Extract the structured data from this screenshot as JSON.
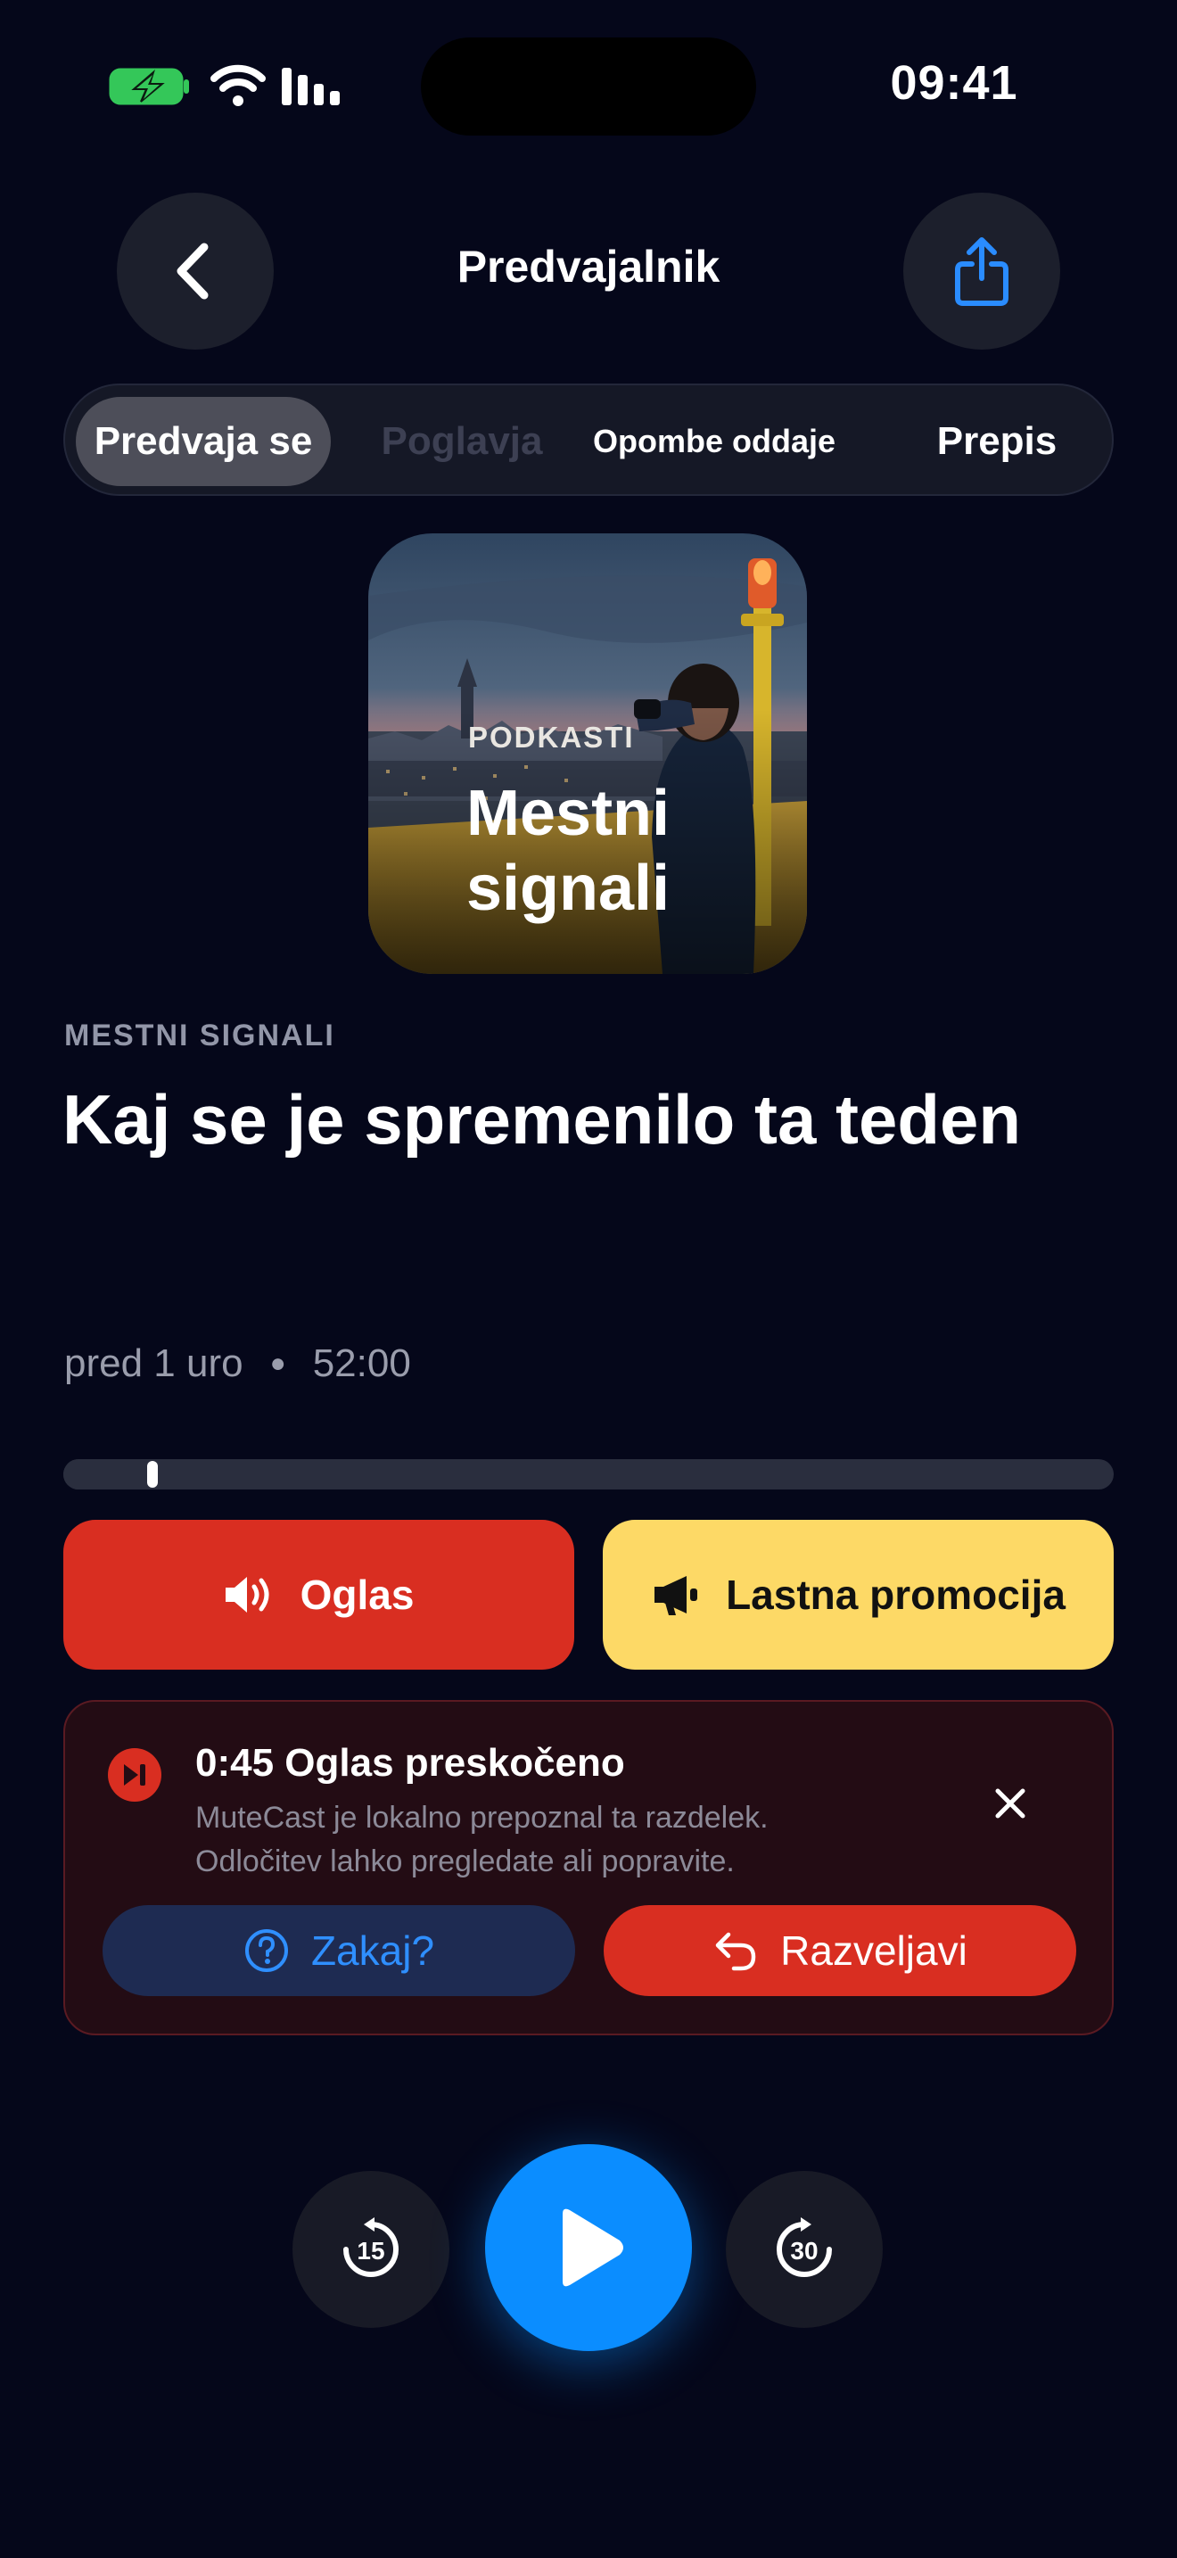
{
  "status_bar": {
    "time": "09:41"
  },
  "header": {
    "title": "Predvajalnik"
  },
  "tabs": [
    {
      "label": "Predvaja se",
      "active": true
    },
    {
      "label": "Poglavja",
      "active": false
    },
    {
      "label": "Opombe oddaje",
      "active": false
    },
    {
      "label": "Prepis",
      "active": false
    }
  ],
  "artwork": {
    "kicker": "PODKASTI",
    "title_line1": "Mestni",
    "title_line2": "signali"
  },
  "episode": {
    "show": "MESTNI SIGNALI",
    "title": "Kaj se je spremenilo ta teden",
    "published": "pred 1 uro",
    "duration": "52:00",
    "progress": 0.085
  },
  "segments": {
    "ad_label": "Oglas",
    "promo_label": "Lastna promocija"
  },
  "skip_notice": {
    "title": "0:45 Oglas preskočeno",
    "line1": "MuteCast je lokalno prepoznal ta razdelek.",
    "line2": "Odločitev lahko pregledate ali popravite.",
    "why_label": "Zakaj?",
    "undo_label": "Razveljavi"
  },
  "controls": {
    "rewind_seconds": "15",
    "forward_seconds": "30"
  },
  "colors": {
    "background": "#05071a",
    "accent": "#0b8dff",
    "ad": "#d92e21",
    "promo": "#fdd966"
  },
  "icons": [
    "battery-charging-icon",
    "wifi-icon",
    "signal-icon",
    "chevron-left-icon",
    "share-icon",
    "speaker-icon",
    "megaphone-icon",
    "skip-forward-icon",
    "close-icon",
    "question-icon",
    "undo-icon",
    "rewind-15-icon",
    "play-icon",
    "forward-30-icon"
  ]
}
